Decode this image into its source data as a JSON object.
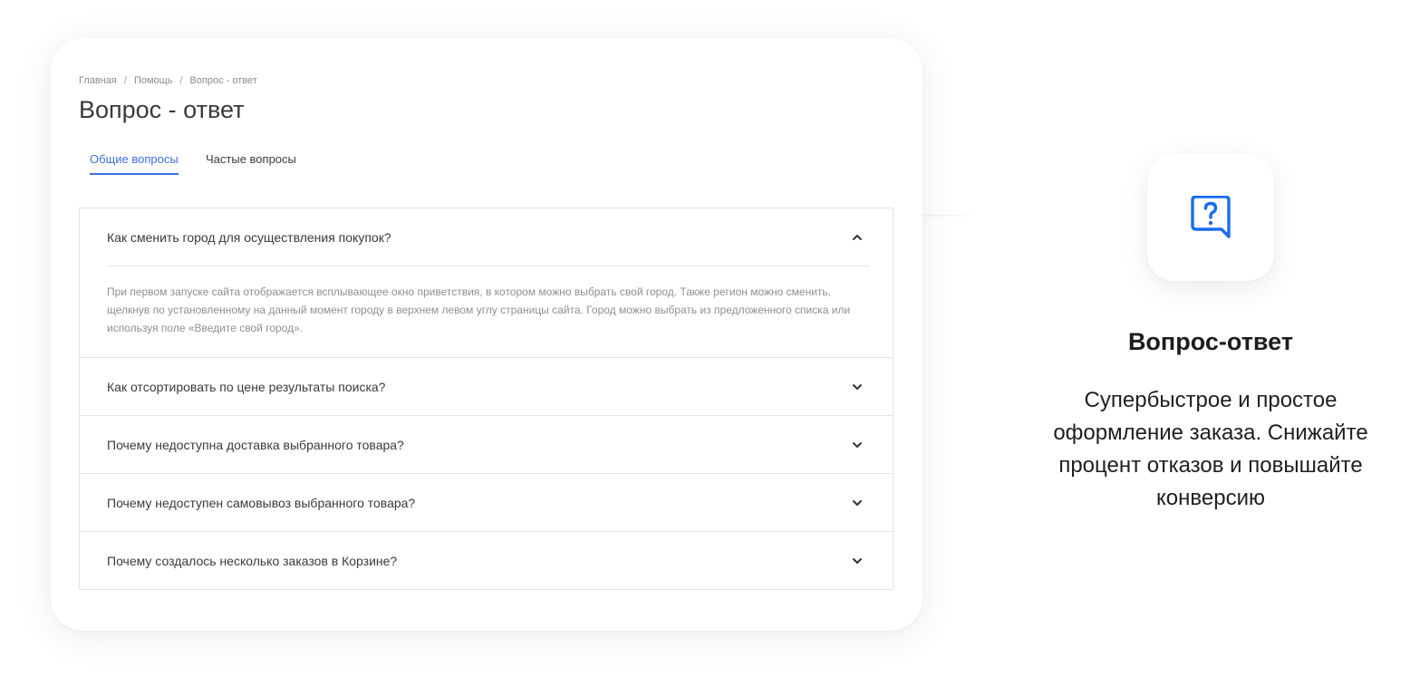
{
  "breadcrumb": {
    "items": [
      "Главная",
      "Помощь",
      "Вопрос - ответ"
    ],
    "separator": "/"
  },
  "page_title": "Вопрос - ответ",
  "tabs": [
    {
      "label": "Общие вопросы",
      "active": true
    },
    {
      "label": "Частые вопросы",
      "active": false
    }
  ],
  "faq": [
    {
      "question": "Как сменить город для осуществления покупок?",
      "expanded": true,
      "answer": "При первом запуске сайта отображается всплывающее окно приветствия, в котором можно выбрать свой город. Также регион можно сменить, щелкнув по установленному на данный момент городу в верхнем левом углу страницы сайта. Город можно выбрать из предложенного списка или используя поле «Введите свой город»."
    },
    {
      "question": "Как отсортировать по цене результаты поиска?",
      "expanded": false
    },
    {
      "question": "Почему недоступна доставка выбранного товара?",
      "expanded": false
    },
    {
      "question": "Почему недоступен самовывоз выбранного товара?",
      "expanded": false
    },
    {
      "question": "Почему создалось несколько заказов в Корзине?",
      "expanded": false
    }
  ],
  "feature": {
    "icon": "question-chat-icon",
    "title": "Вопрос-ответ",
    "description": "Супербыстрое и простое оформление заказа. Снижайте процент отказов и повышайте конверсию"
  },
  "colors": {
    "accent": "#3d6fd8",
    "icon_blue": "#1a6cf0",
    "text_primary": "#3a3a3a",
    "text_muted": "#8f8f8f",
    "border": "#e4e4e4"
  }
}
